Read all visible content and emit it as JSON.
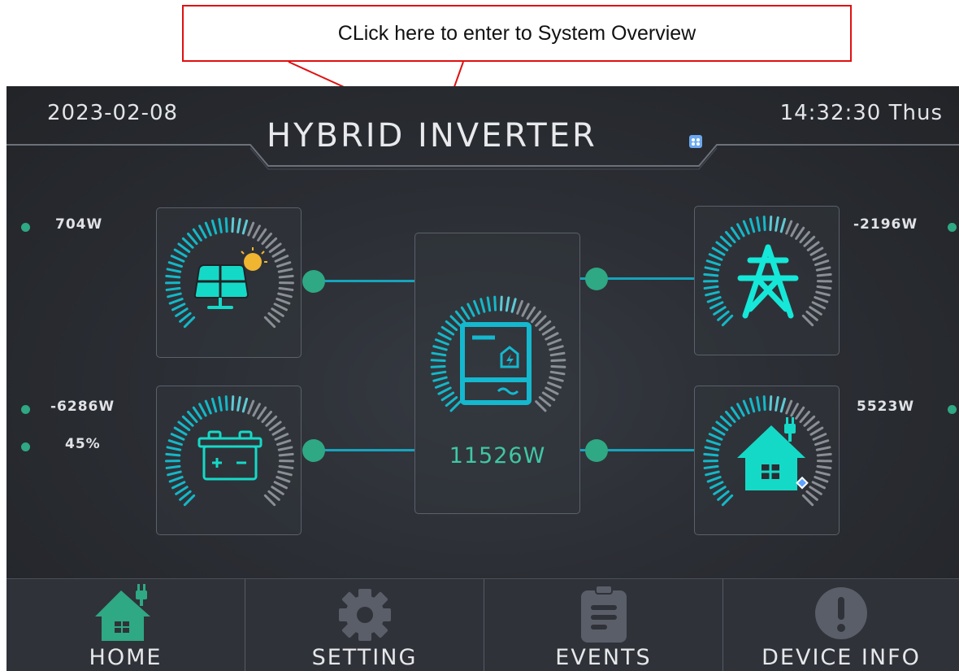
{
  "annotation": {
    "text": "CLick here to enter to System Overview"
  },
  "header": {
    "date": "2023-02-08",
    "time": "14:32:30 Thus",
    "title": "HYBRID INVERTER"
  },
  "flows": {
    "pv": {
      "value": "704W"
    },
    "grid": {
      "value": "-2196W"
    },
    "battery": {
      "power": "-6286W",
      "soc": "45%"
    },
    "load": {
      "value": "5523W"
    },
    "inverter": {
      "value": "11526W"
    }
  },
  "nav": {
    "items": [
      {
        "label": "HOME",
        "icon": "home-icon"
      },
      {
        "label": "SETTING",
        "icon": "gear-icon"
      },
      {
        "label": "EVENTS",
        "icon": "clipboard-icon"
      },
      {
        "label": "DEVICE INFO",
        "icon": "alert-circle-icon"
      }
    ]
  },
  "colors": {
    "accent": "#2fa884",
    "cyan": "#14c7c4",
    "wire": "#15a4bd",
    "value_text": "#3fc7a4"
  }
}
